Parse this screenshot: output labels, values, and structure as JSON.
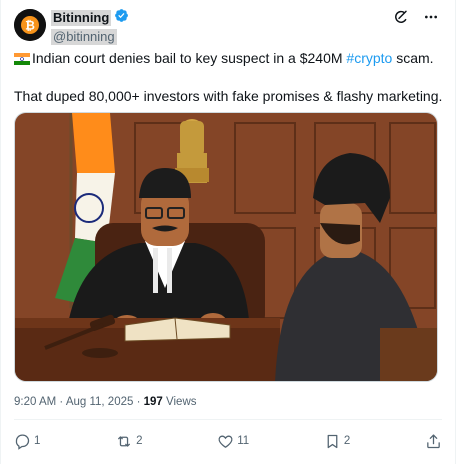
{
  "author": {
    "name": "Bitinning",
    "handle": "@bitinning",
    "verified_color": "#1d9bf0",
    "avatar_icon": "bitcoin-logo"
  },
  "tweet": {
    "line1_flag": "india-flag-emoji",
    "line1_before": "Indian court denies bail to key suspect in a $240M ",
    "line1_hashtag": "#crypto",
    "line1_after": " scam.",
    "line2": "That duped 80,000+ investors with fake promises & flashy marketing."
  },
  "meta": {
    "time": "9:20 AM",
    "separator": "·",
    "date": "Aug 11, 2025",
    "views_count": "197",
    "views_label": "Views"
  },
  "actions": {
    "replies": "1",
    "reposts": "2",
    "likes": "11",
    "bookmarks": "2"
  },
  "colors": {
    "text": "#0f1419",
    "secondary": "#536471",
    "link": "#1d9bf0"
  }
}
